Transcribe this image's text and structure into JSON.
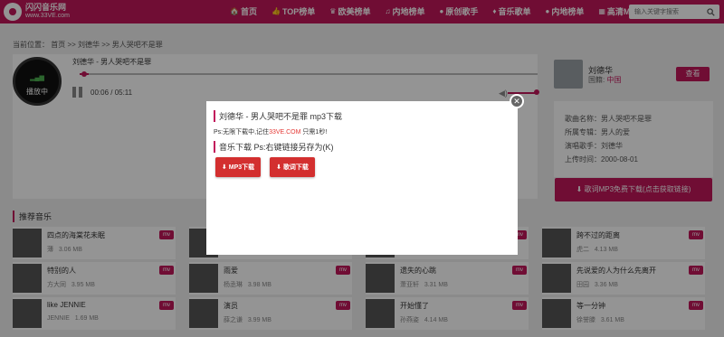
{
  "brand": {
    "name": "闪闪音乐网",
    "url": "www.33VE.com"
  },
  "nav": [
    {
      "icon": "🏠",
      "label": "首页"
    },
    {
      "icon": "👍",
      "label": "TOP榜单"
    },
    {
      "icon": "♛",
      "label": "欧美榜单"
    },
    {
      "icon": "♫",
      "label": "内地榜单"
    },
    {
      "icon": "●",
      "label": "原创歌手"
    },
    {
      "icon": "♦",
      "label": "音乐歌单"
    },
    {
      "icon": "●",
      "label": "内地榜单"
    },
    {
      "icon": "▦",
      "label": "高清MV"
    }
  ],
  "search": {
    "placeholder": "输入关键字搜索"
  },
  "breadcrumb": "当前位置： 首页 >> 刘德华 >> 男人哭吧不是罪",
  "player": {
    "disc_label": "播放中",
    "song": "刘德华 - 男人哭吧不是罪",
    "time": "00:06 / 05:11",
    "progress": 0.02
  },
  "artist": {
    "name": "刘德华",
    "region_label": "国籍:",
    "region": "中国",
    "view_label": "查看"
  },
  "info": [
    {
      "label": "歌曲名称：",
      "value": "男人哭吧不是罪"
    },
    {
      "label": "所属专辑：",
      "value": "男人的爱"
    },
    {
      "label": "演唱歌手：",
      "value": "刘德华"
    },
    {
      "label": "上传时间：",
      "value": "2000-08-01"
    }
  ],
  "free_download": "歌词MP3免费下载(点击获取链接)",
  "recommend": {
    "title": "推荐音乐",
    "items": [
      {
        "title": "四点的海棠花未眠",
        "artist": "薄",
        "size": "3.06 MB",
        "badge": "mv"
      },
      {
        "title": "",
        "artist": "",
        "size": "",
        "badge": "mv"
      },
      {
        "title": "",
        "artist": "",
        "size": "",
        "badge": "mv"
      },
      {
        "title": "跨不过的距离",
        "artist": "虎二",
        "size": "4.13 MB",
        "badge": "mv"
      },
      {
        "title": "特别的人",
        "artist": "方大同",
        "size": "3.95 MB",
        "badge": "mv"
      },
      {
        "title": "雨爱",
        "artist": "杨丞琳",
        "size": "3.98 MB",
        "badge": "mv"
      },
      {
        "title": "遗失的心跳",
        "artist": "萧亚轩",
        "size": "3.31 MB",
        "badge": "mv"
      },
      {
        "title": "先说爱的人为什么先离开",
        "artist": "田园",
        "size": "3.36 MB",
        "badge": "mv"
      },
      {
        "title": "like JENNIE",
        "artist": "JENNIE",
        "size": "1.69 MB",
        "badge": "mv"
      },
      {
        "title": "演员",
        "artist": "薛之谦",
        "size": "3.99 MB",
        "badge": "mv"
      },
      {
        "title": "开始懂了",
        "artist": "孙燕姿",
        "size": "4.14 MB",
        "badge": "mv"
      },
      {
        "title": "等一分钟",
        "artist": "徐誉滕",
        "size": "3.61 MB",
        "badge": "mv"
      }
    ]
  },
  "modal": {
    "title": "刘德华 - 男人哭吧不是罪 mp3下载",
    "note_prefix": "Ps:无限下载中,记住",
    "note_site": "33VE.COM",
    "note_suffix": "只需1秒!",
    "subtitle": "音乐下载 Ps:右键链接另存为(K)",
    "mp3_label": "MP3下载",
    "lyrics_label": "歌词下载",
    "close_symbol": "✕"
  },
  "colors": {
    "accent": "#c2185b",
    "download": "#d32f2f"
  }
}
